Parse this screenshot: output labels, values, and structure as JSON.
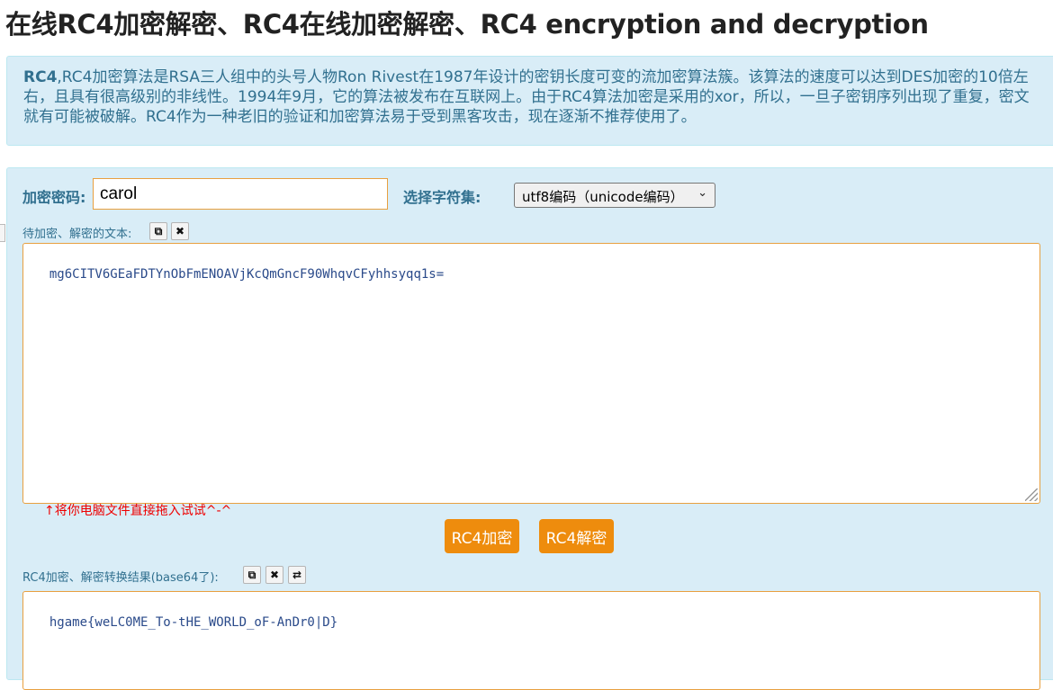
{
  "title": "在线RC4加密解密、RC4在线加密解密、RC4 encryption and decryption",
  "intro": {
    "bold": "RC4",
    "text": ",RC4加密算法是RSA三人组中的头号人物Ron Rivest在1987年设计的密钥长度可变的流加密算法簇。该算法的速度可以达到DES加密的10倍左右，且具有很高级别的非线性。1994年9月，它的算法被发布在互联网上。由于RC4算法加密是采用的xor，所以，一旦子密钥序列出现了重复，密文就有可能被破解。RC4作为一种老旧的验证和加密算法易于受到黑客攻击，现在逐渐不推荐使用了。"
  },
  "form": {
    "password_label": "加密密码:",
    "password_value": "carol",
    "charset_label": "选择字符集:",
    "charset_value": "utf8编码（unicode编码）"
  },
  "input_section": {
    "label": "待加密、解密的文本:",
    "text": "mg6CITV6GEaFDTYnObFmENOAVjKcQmGncF90WhqvCFyhhsyqq1s=",
    "hint": "↑将你电脑文件直接拖入试试^-^"
  },
  "buttons": {
    "encrypt": "RC4加密",
    "decrypt": "RC4解密"
  },
  "output_section": {
    "label": "RC4加密、解密转换结果(base64了):",
    "text": "hgame{weLC0ME_To-tHE_WORLD_oF-AnDr0|D}"
  },
  "icons": {
    "copy": "copy-icon",
    "clear": "close-icon",
    "swap": "swap-icon"
  },
  "colors": {
    "panel_bg": "#d9edf7",
    "label_text": "#31708f",
    "accent_orange": "#ee8c0d",
    "hint_red": "#e00000"
  }
}
